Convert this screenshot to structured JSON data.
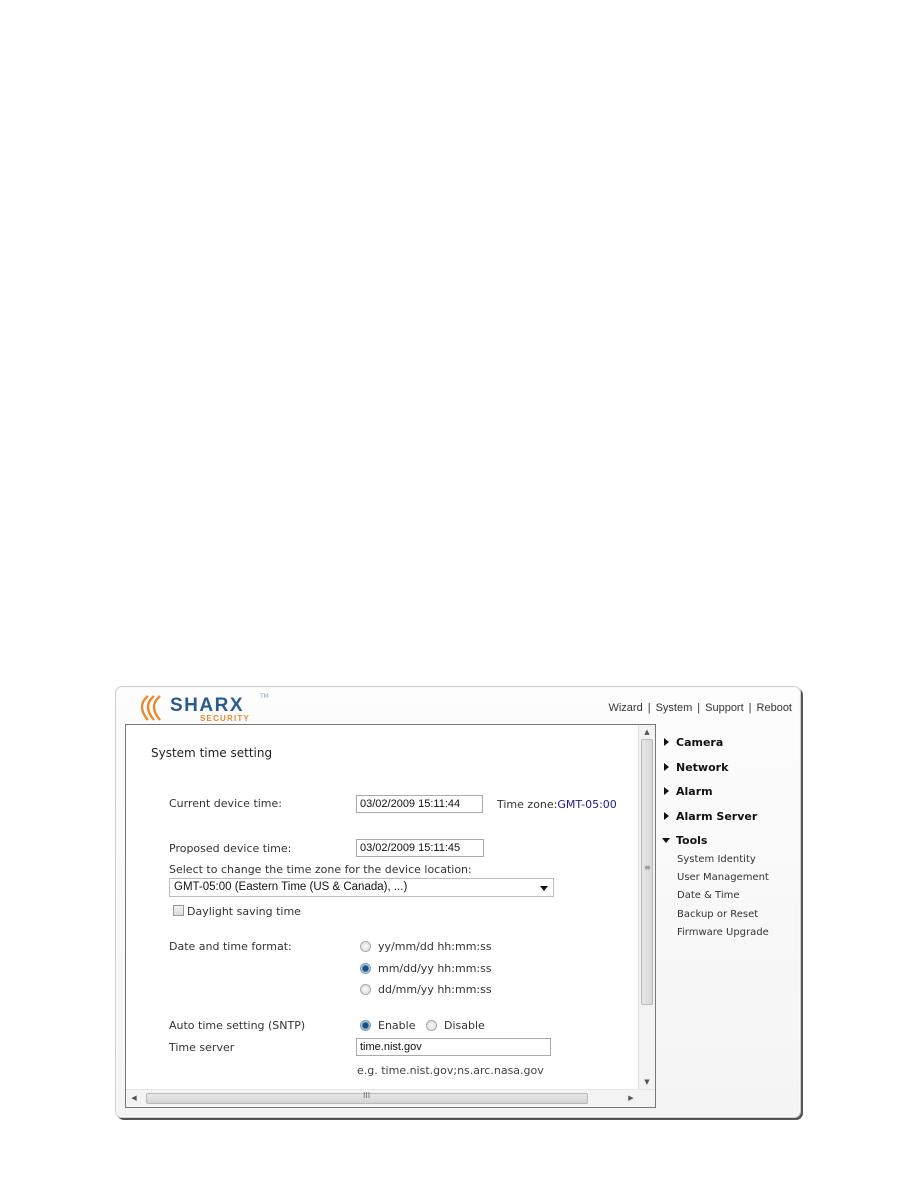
{
  "brand": {
    "name": "SHARX",
    "sub": "SECURITY",
    "tm": "TM",
    "colors": {
      "primary": "#2b5a8c",
      "accent": "#e8892b"
    }
  },
  "topnav": {
    "items": [
      "Wizard",
      "System",
      "Support",
      "Reboot"
    ],
    "separator": "|"
  },
  "main": {
    "title": "System time setting",
    "current_time": {
      "label": "Current device time:",
      "value": "03/02/2009 15:11:44",
      "timezone_label": "Time zone:",
      "timezone_value": "GMT-05:00"
    },
    "proposed_time": {
      "label": "Proposed device time:",
      "value": "03/02/2009 15:11:45"
    },
    "timezone_select": {
      "label": "Select to change the time zone for the device location:",
      "value": "GMT-05:00 (Eastern Time (US & Canada), ...)"
    },
    "daylight": {
      "label": "Daylight saving time",
      "checked": false
    },
    "format": {
      "label": "Date and time format:",
      "options": [
        "yy/mm/dd hh:mm:ss",
        "mm/dd/yy hh:mm:ss",
        "dd/mm/yy hh:mm:ss"
      ],
      "selected": 1
    },
    "sntp": {
      "label": "Auto time setting (SNTP)",
      "options": [
        "Enable",
        "Disable"
      ],
      "selected": 0
    },
    "time_server": {
      "label": "Time server",
      "value": "time.nist.gov",
      "hint": "e.g. time.nist.gov;ns.arc.nasa.gov"
    }
  },
  "sidebar": {
    "groups": [
      {
        "label": "Camera",
        "expanded": false
      },
      {
        "label": "Network",
        "expanded": false
      },
      {
        "label": "Alarm",
        "expanded": false
      },
      {
        "label": "Alarm Server",
        "expanded": false
      },
      {
        "label": "Tools",
        "expanded": true
      }
    ],
    "tools_items": [
      "System Identity",
      "User Management",
      "Date & Time",
      "Backup or Reset",
      "Firmware Upgrade"
    ]
  },
  "scrollbars": {
    "vertical_grip": "≡",
    "horizontal_grip": "III"
  }
}
